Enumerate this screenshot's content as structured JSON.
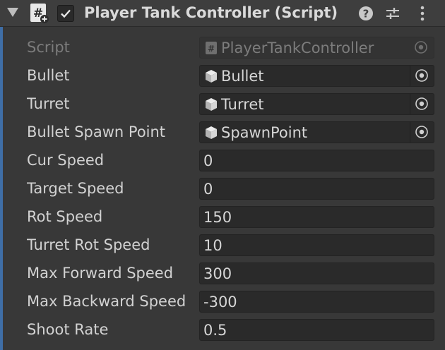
{
  "component": {
    "title": "Player Tank Controller (Script)",
    "enabled": true
  },
  "header_icons": {
    "script": "script-component-icon",
    "help": "help-icon",
    "presets": "presets-icon",
    "menu": "kebab-menu-icon"
  },
  "fields": {
    "script": {
      "label": "Script",
      "value": "PlayerTankController"
    },
    "bullet": {
      "label": "Bullet",
      "value": "Bullet"
    },
    "turret": {
      "label": "Turret",
      "value": "Turret"
    },
    "bullet_spawn_point": {
      "label": "Bullet Spawn Point",
      "value": "SpawnPoint"
    },
    "cur_speed": {
      "label": "Cur Speed",
      "value": "0"
    },
    "target_speed": {
      "label": "Target Speed",
      "value": "0"
    },
    "rot_speed": {
      "label": "Rot Speed",
      "value": "150"
    },
    "turret_rot_speed": {
      "label": "Turret Rot Speed",
      "value": "10"
    },
    "max_forward_speed": {
      "label": "Max Forward Speed",
      "value": "300"
    },
    "max_backward_speed": {
      "label": "Max Backward Speed",
      "value": "-300"
    },
    "shoot_rate": {
      "label": "Shoot Rate",
      "value": "0.5"
    }
  },
  "colors": {
    "background": "#383838",
    "field": "#2a2a2a",
    "accent": "#3f6ea6",
    "text": "#d2d2d2",
    "disabled_text": "#7c7c7c"
  }
}
